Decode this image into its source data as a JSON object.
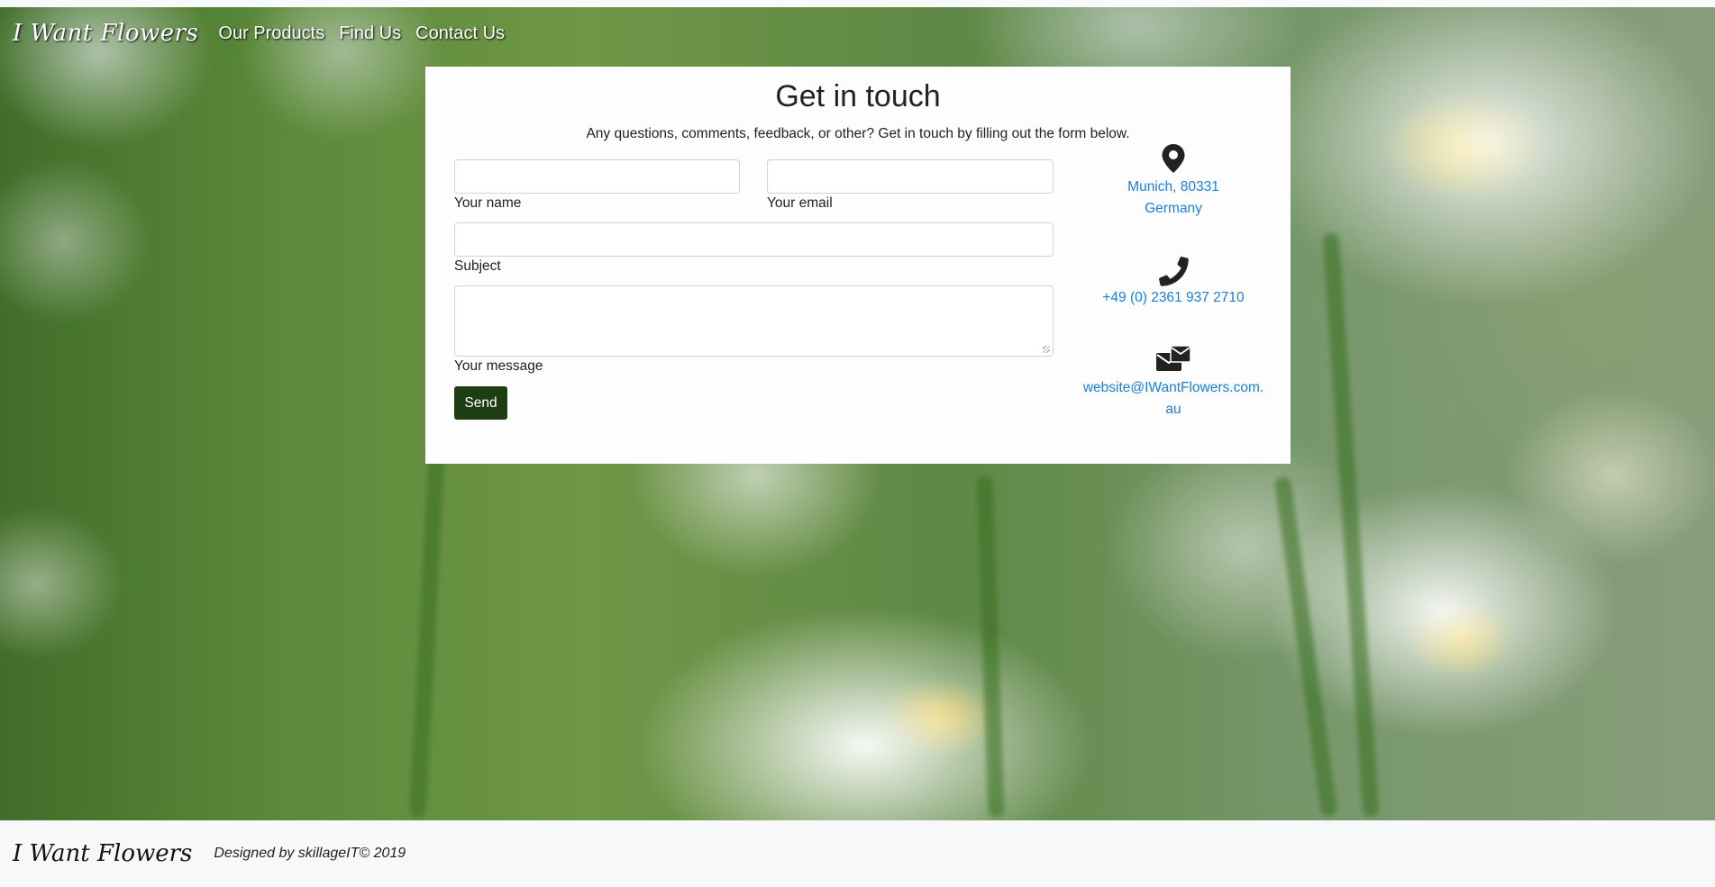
{
  "navbar": {
    "brand": "I Want Flowers",
    "links": [
      "Our Products",
      "Find Us",
      "Contact Us"
    ]
  },
  "contact": {
    "title": "Get in touch",
    "intro": "Any questions, comments, feedback, or other? Get in touch by filling out the form below.",
    "form": {
      "name_label": "Your name",
      "email_label": "Your email",
      "subject_label": "Subject",
      "message_label": "Your message",
      "send_label": "Send"
    },
    "info": {
      "address_line1": "Munich, 80331",
      "address_line2": "Germany",
      "phone": "+49 (0) 2361 937 2710",
      "email_line1": "website@IWantFlowers.com.",
      "email_line2": "au"
    },
    "icons": [
      "map-marker-icon",
      "phone-icon",
      "envelope-icon"
    ]
  },
  "footer": {
    "brand": "I Want Flowers",
    "credit": "Designed by skillageIT© 2019"
  },
  "colors": {
    "link": "#1a80d8",
    "button": "#1f3d12",
    "footer_bg": "#f7f8fa"
  }
}
